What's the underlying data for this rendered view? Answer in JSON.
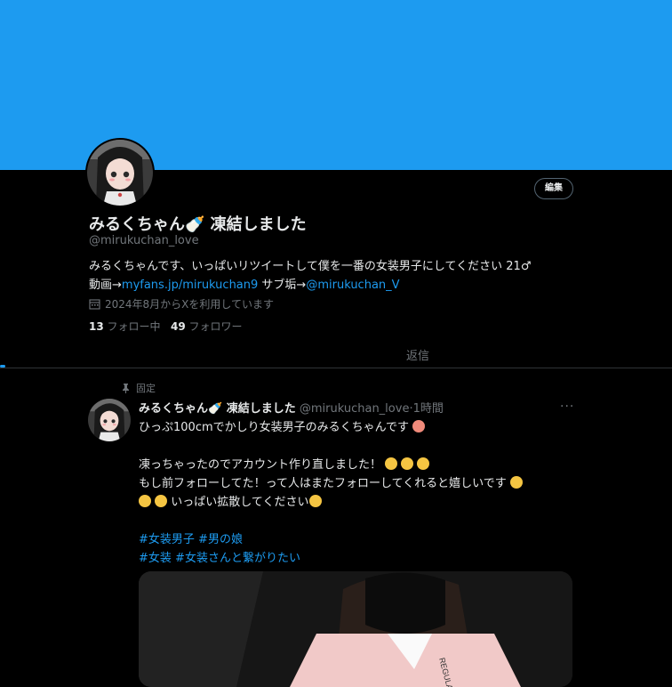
{
  "colors": {
    "banner": "#1d9bf0",
    "accent": "#1d9bf0",
    "muted": "#71767b",
    "background": "#000000"
  },
  "profile": {
    "edit_label": "編集",
    "display_name": "みるくちゃん🍼 凍結しました",
    "handle": "@mirukuchan_love",
    "bio_line1": "みるくちゃんです、いっぱいリツイートして僕を一番の女装男子にしてください 21♂",
    "bio_prefix": "動画→",
    "bio_link1": "myfans.jp/mirukuchan9",
    "bio_mid": " サブ垢→",
    "bio_link2": "@mirukuchan_V",
    "joined": "2024年8月からXを利用しています",
    "following_count": "13",
    "following_label": "フォロー中",
    "followers_count": "49",
    "followers_label": "フォロワー"
  },
  "tabs": {
    "replies_label": "返信"
  },
  "tweet": {
    "pinned_label": "固定",
    "author_name": "みるくちゃん🍼 凍結しました",
    "author_handle": "@mirukuchan_love",
    "separator": "·",
    "time": "1時間",
    "more_label": "···",
    "line1": "ひっぷ100cmでかしり女装男子のみるくちゃんです",
    "line2": "凍っちゃったのでアカウント作り直しました！",
    "line3": "もし前フォローしてた！って人はまたフォローしてくれると嬉しいです",
    "line4": "いっぱい拡散してください",
    "hashtag1": "#女装男子",
    "hashtag2": "#男の娘",
    "hashtag3": "#女装",
    "hashtag4": "#女装さんと繋がりたい",
    "media_overlay_text": "REGULAR FIT"
  }
}
